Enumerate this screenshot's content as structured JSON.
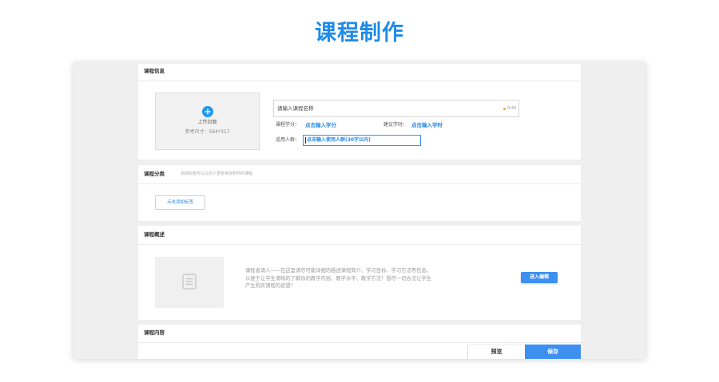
{
  "page": {
    "title": "课程制作"
  },
  "info": {
    "header": "课程信息",
    "cover": {
      "label": "上传封面",
      "size_hint": "参考尺寸：564*317"
    },
    "course_name": {
      "placeholder": "请输入课程名称",
      "counter": "0/40"
    },
    "credit": {
      "label": "课程学分：",
      "action": "点击输入学分"
    },
    "hours": {
      "label": "建议学时：",
      "action": "点击输入学时"
    },
    "audience": {
      "label": "适用人群：",
      "value": "点击输入使用人群(30字以内)"
    }
  },
  "category": {
    "header": "课程分类",
    "hint": "添加标签可以让别人更容易找到你的课程",
    "add_button": "点击添加标签"
  },
  "overview": {
    "header": "课程概述",
    "description": [
      "课程者请人——在这里请尽可能详细的描述课程简介、学习目标、学习方法等信息，",
      "以便于让学生清晰的了解你的教学内容、教学水平、教学方法！想尽一切办法让学生",
      "产生购买课程的欲望！"
    ],
    "edit_button": "进入编辑"
  },
  "content": {
    "header": "课程内容"
  },
  "footer": {
    "preview_button": "预览",
    "save_button": "保存"
  },
  "icons": {
    "cover_upload": "plus-circle-icon",
    "overview_placeholder": "document-icon",
    "counter_status": "status-dot"
  },
  "colors": {
    "title": "#1f8be8",
    "accent": "#3d8ff0",
    "link": "#2489e8",
    "status_dot": "#f5a623",
    "panel_bg": "#efefef"
  }
}
